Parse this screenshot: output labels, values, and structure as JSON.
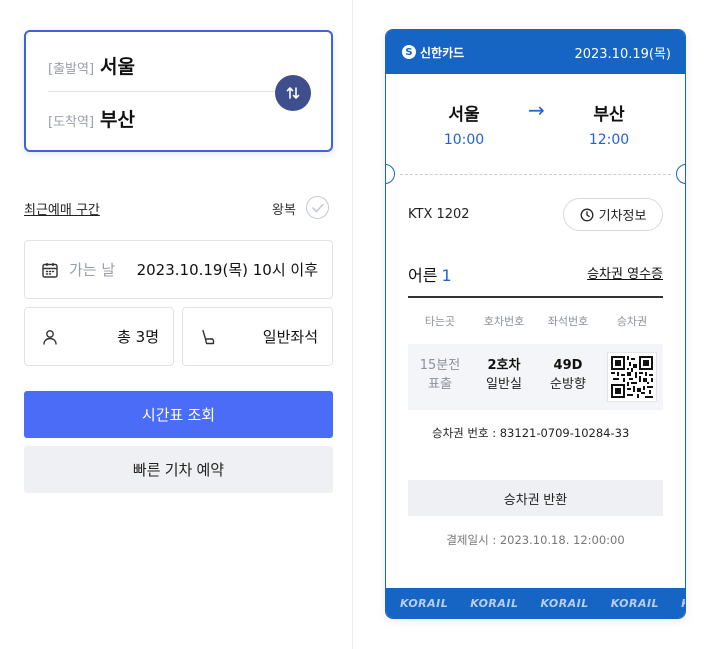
{
  "search": {
    "departure_tag": "[출발역]",
    "departure_station": "서울",
    "arrival_tag": "[도착역]",
    "arrival_station": "부산",
    "recent_label": "최근예매 구간",
    "roundtrip_label": "왕복",
    "date_label": "가는 날",
    "date_value": "2023.10.19(목) 10시 이후",
    "passengers_value": "총 3명",
    "seat_value": "일반좌석",
    "search_button": "시간표 조회",
    "quick_button": "빠른 기차 예약"
  },
  "ticket": {
    "card_brand": "신한카드",
    "date": "2023.10.19(목)",
    "from_city": "서울",
    "from_time": "10:00",
    "to_city": "부산",
    "to_time": "12:00",
    "train": "KTX 1202",
    "train_info_button": "기차정보",
    "passenger_type": "어른",
    "passenger_count": "1",
    "receipt_link": "승차권 영수증",
    "columns": [
      "타는곳",
      "호차번호",
      "좌석번호",
      "승차권"
    ],
    "platform": [
      "15분전",
      "표출"
    ],
    "car": [
      "2호차",
      "일반실"
    ],
    "seat": [
      "49D",
      "순방향"
    ],
    "ticket_number": "승차권 번호 : 83121-0709-10284-33",
    "refund_button": "승차권 반환",
    "paid_at": "결제일시 : 2023.10.18. 12:00:00",
    "strip_logo": "KORAIL"
  },
  "colors": {
    "accent": "#3d63dd",
    "primary_button": "#4a6cf7",
    "ticket_blue": "#1664c4",
    "swap_button": "#3f4e8c"
  }
}
